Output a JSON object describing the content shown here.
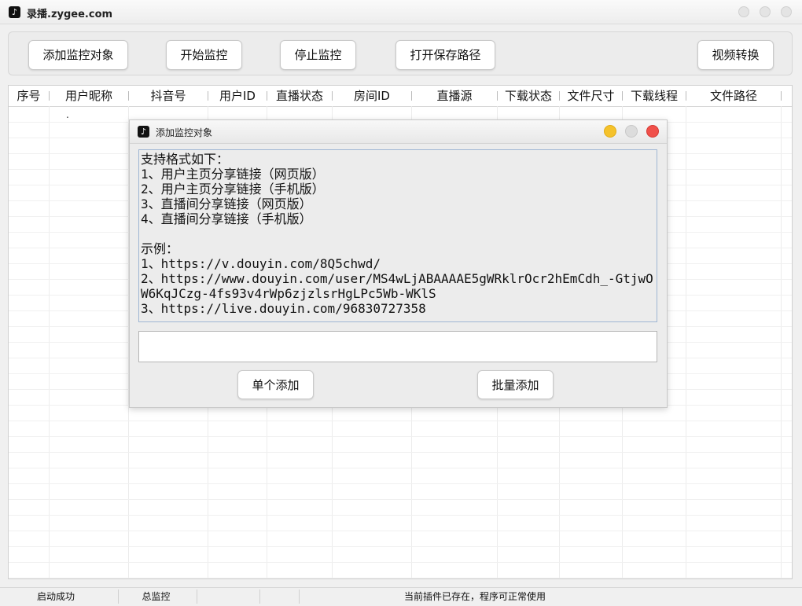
{
  "window": {
    "title": "录播.zygee.com",
    "app_icon": "tiktok-icon"
  },
  "toolbar": {
    "add_target": "添加监控对象",
    "start_monitor": "开始监控",
    "stop_monitor": "停止监控",
    "open_save_path": "打开保存路径",
    "video_convert": "视频转换"
  },
  "table": {
    "columns": [
      "序号",
      "用户昵称",
      "抖音号",
      "用户ID",
      "直播状态",
      "房间ID",
      "直播源",
      "下载状态",
      "文件尺寸",
      "下载线程",
      "文件路径"
    ],
    "first_row_mark": "."
  },
  "dialog": {
    "title": "添加监控对象",
    "info_lines": [
      "支持格式如下：",
      "1、用户主页分享链接（网页版）",
      "2、用户主页分享链接（手机版）",
      "3、直播间分享链接（网页版）",
      "4、直播间分享链接（手机版）",
      "",
      "示例：",
      "1、https://v.douyin.com/8Q5chwd/",
      "2、https://www.douyin.com/user/MS4wLjABAAAAE5gWRklrOcr2hEmCdh_-GtjwOW6KqJCzg-4fs93v4rWp6zjzlsrHgLPc5Wb-WKlS",
      "3、https://live.douyin.com/96830727358"
    ],
    "url_input_value": "",
    "single_add": "单个添加",
    "batch_add": "批量添加",
    "colors": {
      "minimize": "#f5c22b",
      "maximize": "#dcdcdc",
      "close": "#f0504a"
    }
  },
  "status": {
    "left": "启动成功",
    "monitor": "总监控",
    "message": "当前插件已存在，程序可正常使用"
  }
}
